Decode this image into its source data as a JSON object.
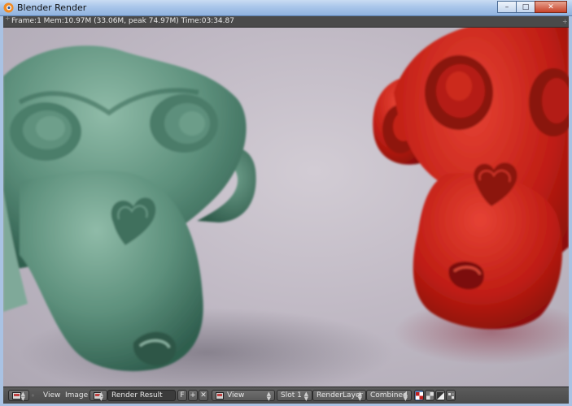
{
  "window": {
    "title": "Blender Render",
    "minimize_glyph": "–",
    "maximize_glyph": "□",
    "close_glyph": "✕"
  },
  "info": {
    "text": "Frame:1 Mem:10.97M (33.06M, peak 74.97M) Time:03:34.87"
  },
  "scene": {
    "background_color": "#c2bcc6",
    "green_monkey_color": "#4f8a73",
    "red_monkey_color": "#c8221a"
  },
  "bottom": {
    "menu_view": "View",
    "menu_image": "Image",
    "image_name": "Render Result",
    "fake_user": "F",
    "view_select": "View",
    "slot": "Slot 1",
    "render_layer": "RenderLayer",
    "pass": "Combined"
  }
}
